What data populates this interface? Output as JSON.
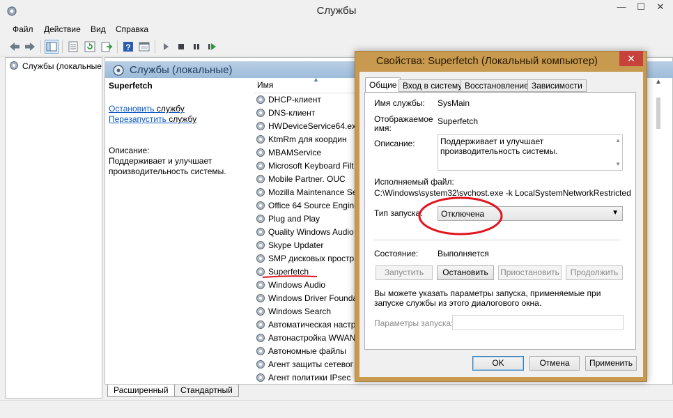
{
  "window": {
    "title": "Службы"
  },
  "menu": [
    "Файл",
    "Действие",
    "Вид",
    "Справка"
  ],
  "toolbar": {
    "icons": [
      "back-icon",
      "forward-icon",
      "show-tree-icon",
      "properties-icon",
      "refresh-icon",
      "export-icon",
      "help-icon",
      "console-icon",
      "play-icon",
      "stop-icon",
      "pause-icon",
      "restart-icon"
    ]
  },
  "tree": {
    "root_label": "Службы (локальные"
  },
  "header": {
    "title": "Службы (локальные)"
  },
  "details": {
    "service_name": "Superfetch",
    "stop_link": "Остановить",
    "stop_suffix": " службу",
    "restart_link": "Перезапустить",
    "restart_suffix": " службу",
    "description_label": "Описание:",
    "description_text": "Поддерживает и улучшает производительность системы."
  },
  "list": {
    "column_name": "Имя",
    "services": [
      "DHCP-клиент",
      "DNS-клиент",
      "HWDeviceService64.exe",
      "KtmRm для координ",
      "MBAMService",
      "Microsoft Keyboard Filt",
      "Mobile Partner. OUC",
      "Mozilla Maintenance Se",
      "Office 64 Source Engine",
      "Plug and Play",
      "Quality Windows Audio",
      "Skype Updater",
      "SMP дисковых простра",
      "Superfetch",
      "Windows Audio",
      "Windows Driver Founda",
      "Windows Search",
      "Автоматическая настр",
      "Автонастройка WWAN",
      "Автономные файлы",
      "Агент защиты сетевог",
      "Агент политики IPsec"
    ]
  },
  "bottom_tabs": [
    "Расширенный",
    "Стандартный"
  ],
  "dialog": {
    "title": "Свойства: Superfetch (Локальный компьютер)",
    "close": "✕",
    "tabs": [
      "Общие",
      "Вход в систему",
      "Восстановление",
      "Зависимости"
    ],
    "service_name_label": "Имя службы:",
    "service_name_value": "SysMain",
    "display_name_label": "Отображаемое имя:",
    "display_name_value": "Superfetch",
    "description_label": "Описание:",
    "description_value": "Поддерживает и улучшает производительность системы.",
    "exec_label": "Исполняемый файл:",
    "exec_value": "C:\\Windows\\system32\\svchost.exe -k LocalSystemNetworkRestricted",
    "startup_type_label": "Тип запуска:",
    "startup_type_value": "Отключена",
    "status_label": "Состояние:",
    "status_value": "Выполняется",
    "btn_start": "Запустить",
    "btn_stop": "Остановить",
    "btn_pause": "Приостановить",
    "btn_resume": "Продолжить",
    "hint": "Вы можете указать параметры запуска, применяемые при запуске службы из этого диалогового окна.",
    "params_label": "Параметры запуска:",
    "params_value": "",
    "btn_ok": "OK",
    "btn_cancel": "Отмена",
    "btn_apply": "Применить"
  },
  "colors": {
    "dialog_frame": "#c89a50",
    "close_button": "#c7423a",
    "link": "#0a58c8",
    "annotation_red": "#e0141e",
    "header_gradient": "#9dbbd9"
  }
}
